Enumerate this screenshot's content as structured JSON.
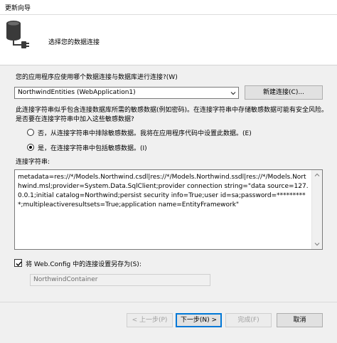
{
  "window": {
    "title": "更新向导"
  },
  "header": {
    "heading": "选择您的数据连接"
  },
  "connection": {
    "question": "您的应用程序应使用哪个数据连接与数据库进行连接?(W)",
    "selected": "NorthwindEntities (WebApplication1)",
    "new_connection_button": "新建连接(C)..."
  },
  "sensitive": {
    "warning": "此连接字符串似乎包含连接数据库所需的敏感数据(例如密码)。在连接字符串中存储敏感数据可能有安全风险。是否要在连接字符串中加入这些敏感数据?",
    "option_no": "否，从连接字符串中排除敏感数据。我将在应用程序代码中设置此数据。(E)",
    "option_yes": "是，在连接字符串中包括敏感数据。(I)"
  },
  "connection_string": {
    "label": "连接字符串:",
    "value": "metadata=res://*/Models.Northwind.csdl|res://*/Models.Northwind.ssdl|res://*/Models.Northwind.msl;provider=System.Data.SqlClient;provider connection string=\"data source=127.0.0.1;initial catalog=Northwind;persist security info=True;user id=sa;password=**********;multipleactiveresultsets=True;application name=EntityFramework\""
  },
  "save_config": {
    "label": "将 Web.Config 中的连接设置另存为(S):",
    "checked": true,
    "name_value": "NorthwindContainer"
  },
  "footer": {
    "back": "< 上一步(P)",
    "next": "下一步(N) >",
    "finish": "完成(F)",
    "cancel": "取消"
  }
}
